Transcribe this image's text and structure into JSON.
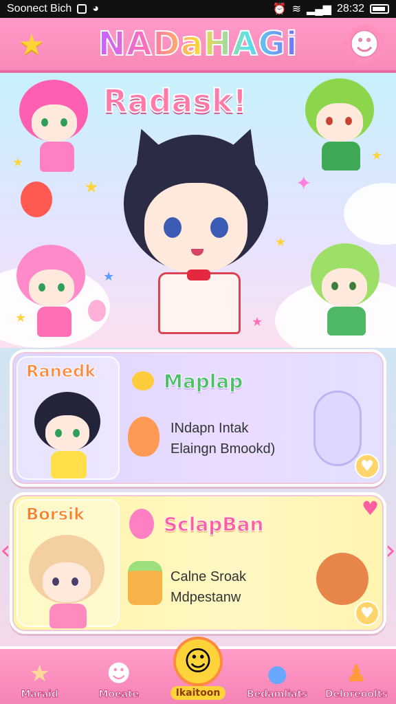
{
  "status_bar": {
    "carrier": "Soonect Bich",
    "time": "28:32"
  },
  "header": {
    "title": "NADaHAGi",
    "left_icon": "star-icon",
    "right_icon": "ghost-icon"
  },
  "hero": {
    "subtitle": "Radask!"
  },
  "cards": [
    {
      "label": "Ranedk",
      "heading": "Maplap",
      "lines": [
        "INdapn Intak",
        "Elaingn Bmookd)"
      ],
      "colors": {
        "bg": "#e3deff"
      }
    },
    {
      "label": "Borsik",
      "heading": "SclapBan",
      "lines": [
        "Calne Sroak",
        "Mdpestanw"
      ],
      "colors": {
        "bg": "#fff6b8"
      }
    }
  ],
  "bottom_nav": {
    "items": [
      {
        "label": "Maraid",
        "icon": "star-icon"
      },
      {
        "label": "Moeate",
        "icon": "ghost-icon"
      },
      {
        "label": "Ikaitoon",
        "icon": "avatar-icon",
        "active": true
      },
      {
        "label": "Bedamliats",
        "icon": "blob-icon"
      },
      {
        "label": "Deloreoolts",
        "icon": "figure-icon"
      }
    ]
  },
  "accent_colors": {
    "header": "#f78ab9",
    "title_gradient": [
      "#c264ff",
      "#ff6fb5",
      "#ffd43b",
      "#5ce1e6"
    ],
    "active_nav": "#ffd43b"
  }
}
